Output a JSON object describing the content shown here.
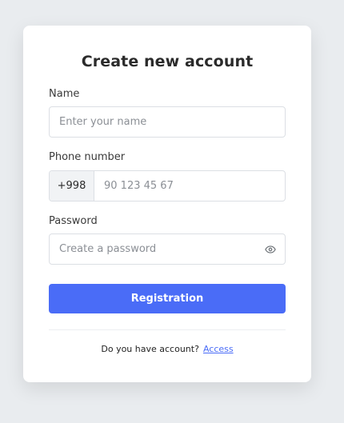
{
  "form": {
    "title": "Create new account",
    "name": {
      "label": "Name",
      "value": "",
      "placeholder": "Enter your name"
    },
    "phone": {
      "label": "Phone number",
      "prefix": "+998",
      "value": "",
      "placeholder": "90 123 45 67"
    },
    "password": {
      "label": "Password",
      "value": "",
      "placeholder": "Create a password",
      "toggle_icon": "eye-icon"
    },
    "submit_label": "Registration",
    "footer_text": "Do you have account?",
    "footer_link": "Access"
  },
  "colors": {
    "background": "#e9ecef",
    "card": "#ffffff",
    "accent": "#4a6cf7",
    "border": "#dcdfe4"
  }
}
